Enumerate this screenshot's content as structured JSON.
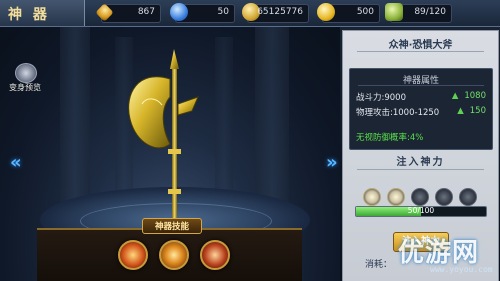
{
  "header": {
    "title": "神 器",
    "resources": [
      {
        "icon": "diamond-icon",
        "value": "867"
      },
      {
        "icon": "blue-gem-icon",
        "value": "50"
      },
      {
        "icon": "gold-coin-icon",
        "value": "65125776"
      },
      {
        "icon": "gold-ingot-icon",
        "value": "500"
      },
      {
        "icon": "bag-capacity-icon",
        "value": "89/120"
      }
    ]
  },
  "view": {
    "preview_label": "变身预览",
    "skill_tab_label": "神器技能",
    "nav_left": "«",
    "nav_right": "»"
  },
  "panel": {
    "weapon_name": "众神·恐惧大斧",
    "attr_title": "神器属性",
    "attrs": [
      {
        "label": "战斗力:9000",
        "arrow": "▲",
        "increase": "1080"
      },
      {
        "label": "物理攻击:1000-1250",
        "arrow": "▲",
        "increase": "150"
      }
    ],
    "special": "无视防御概率:4%",
    "inject_title": "注入神力",
    "progress": {
      "text": "50/100",
      "fraction": 0.5
    },
    "slots_lit": 2,
    "slots_total": 5,
    "inject_button": "注入神力",
    "cost_label": "消耗："
  },
  "watermark": {
    "main": "优游网",
    "sub": "www.yoyou.com"
  },
  "colors": {
    "accent_gold": "#f3dd9a",
    "nav_arrow": "#56b9ff",
    "buff_green": "#58e04a"
  }
}
